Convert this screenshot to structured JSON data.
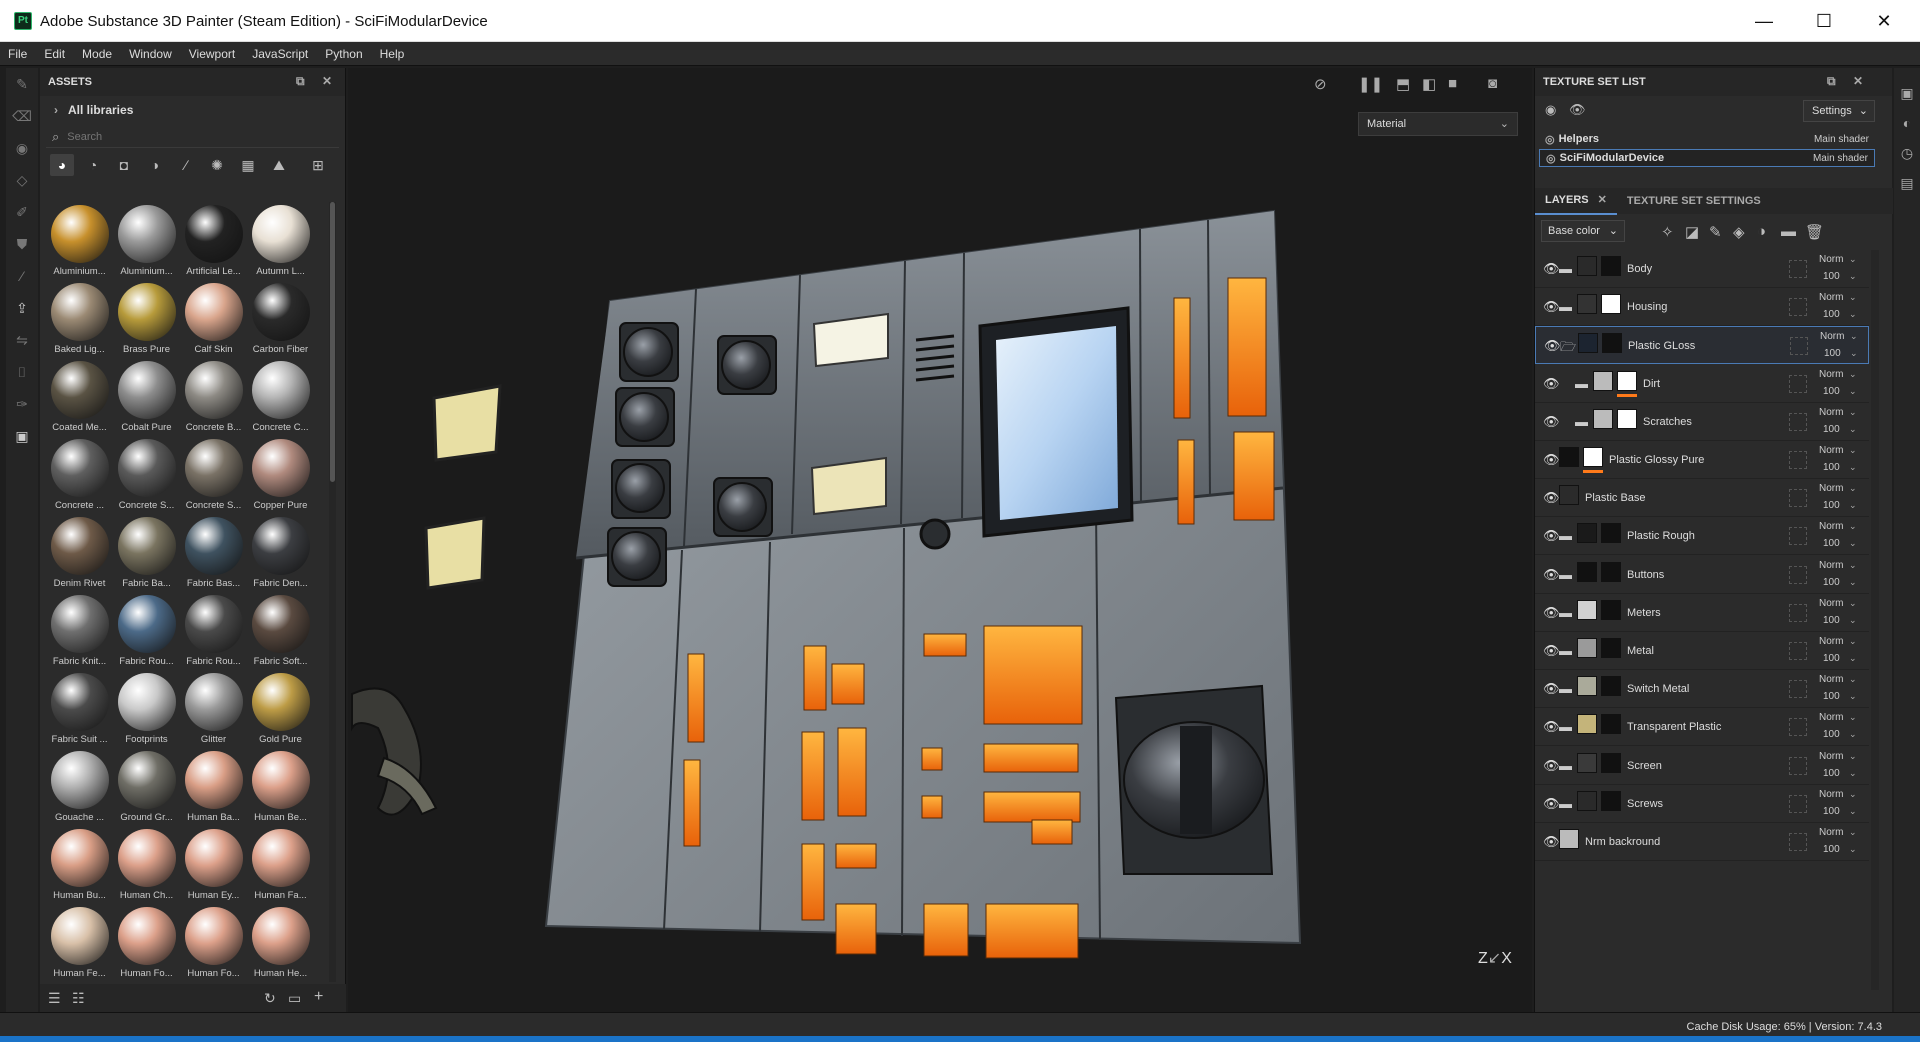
{
  "window": {
    "title": "Adobe Substance 3D Painter (Steam Edition) - SciFiModularDevice",
    "app_icon": "Pt",
    "minimize": "—",
    "maximize": "☐",
    "close": "✕"
  },
  "menu": [
    "File",
    "Edit",
    "Mode",
    "Window",
    "Viewport",
    "JavaScript",
    "Python",
    "Help"
  ],
  "assets": {
    "title": "ASSETS",
    "library": "All libraries",
    "search_placeholder": "Search",
    "items": [
      {
        "label": "Aluminium...",
        "color": "#c7902c"
      },
      {
        "label": "Aluminium...",
        "color": "#9a9a9a"
      },
      {
        "label": "Artificial Le...",
        "color": "#222222"
      },
      {
        "label": "Autumn L...",
        "color": "#e8e0d4"
      },
      {
        "label": "Baked Lig...",
        "color": "#9b8a74"
      },
      {
        "label": "Brass Pure",
        "color": "#b79b3b"
      },
      {
        "label": "Calf Skin",
        "color": "#d9a58c"
      },
      {
        "label": "Carbon Fiber",
        "color": "#2a2a2a"
      },
      {
        "label": "Coated Me...",
        "color": "#5a5344"
      },
      {
        "label": "Cobalt Pure",
        "color": "#8d8d8d"
      },
      {
        "label": "Concrete B...",
        "color": "#8d8a84"
      },
      {
        "label": "Concrete C...",
        "color": "#b5b5b5"
      },
      {
        "label": "Concrete ...",
        "color": "#5f5f5f"
      },
      {
        "label": "Concrete S...",
        "color": "#5a5a5a"
      },
      {
        "label": "Concrete S...",
        "color": "#7a7266"
      },
      {
        "label": "Copper Pure",
        "color": "#b08a7e"
      },
      {
        "label": "Denim Rivet",
        "color": "#6e5a48"
      },
      {
        "label": "Fabric Ba...",
        "color": "#7a7460"
      },
      {
        "label": "Fabric Bas...",
        "color": "#3f5260"
      },
      {
        "label": "Fabric Den...",
        "color": "#3c3e42"
      },
      {
        "label": "Fabric Knit...",
        "color": "#6f6f6f"
      },
      {
        "label": "Fabric Rou...",
        "color": "#4c6a88"
      },
      {
        "label": "Fabric Rou...",
        "color": "#4a4a4a"
      },
      {
        "label": "Fabric Soft...",
        "color": "#5a4a40"
      },
      {
        "label": "Fabric Suit ...",
        "color": "#4b4b4b"
      },
      {
        "label": "Footprints",
        "color": "#c9c9c9"
      },
      {
        "label": "Glitter",
        "color": "#9a9a9a"
      },
      {
        "label": "Gold Pure",
        "color": "#bd9c46"
      },
      {
        "label": "Gouache ...",
        "color": "#b0b0b0"
      },
      {
        "label": "Ground Gr...",
        "color": "#6f6e66"
      },
      {
        "label": "Human Ba...",
        "color": "#d99e86"
      },
      {
        "label": "Human Be...",
        "color": "#dca08a"
      },
      {
        "label": "Human Bu...",
        "color": "#d99e86"
      },
      {
        "label": "Human Ch...",
        "color": "#dca08a"
      },
      {
        "label": "Human Ey...",
        "color": "#dca08a"
      },
      {
        "label": "Human Fa...",
        "color": "#dca08a"
      },
      {
        "label": "Human Fe...",
        "color": "#d8c0a8"
      },
      {
        "label": "Human Fo...",
        "color": "#dca08a"
      },
      {
        "label": "Human Fo...",
        "color": "#dca08a"
      },
      {
        "label": "Human He...",
        "color": "#dca08a"
      }
    ]
  },
  "viewport": {
    "mode": "Material"
  },
  "texture_set_list": {
    "title": "TEXTURE SET LIST",
    "settings": "Settings",
    "sets": [
      {
        "name": "Helpers",
        "shader": "Main shader"
      },
      {
        "name": "SciFiModularDevice",
        "shader": "Main shader"
      }
    ]
  },
  "layers_panel": {
    "tab_layers": "LAYERS",
    "tab_settings": "TEXTURE SET SETTINGS",
    "channel": "Base color",
    "layers": [
      {
        "name": "Body",
        "blend": "Norm",
        "opacity": "100",
        "folder": true,
        "indent": 0,
        "thumb1": "#2a2a2a",
        "thumb2": "#111111",
        "bar": false
      },
      {
        "name": "Housing",
        "blend": "Norm",
        "opacity": "100",
        "folder": true,
        "indent": 0,
        "thumb1": "#333333",
        "thumb2": "#ffffff",
        "bar": false
      },
      {
        "name": "Plastic GLoss",
        "blend": "Norm",
        "opacity": "100",
        "folder": true,
        "indent": 0,
        "thumb1": "#1c2430",
        "thumb2": "#111111",
        "bar": false
      },
      {
        "name": "Dirt",
        "blend": "Norm",
        "opacity": "100",
        "folder": true,
        "indent": 1,
        "thumb1": "#bbbbbb",
        "thumb2": "#ffffff",
        "bar": true
      },
      {
        "name": "Scratches",
        "blend": "Norm",
        "opacity": "100",
        "folder": true,
        "indent": 1,
        "thumb1": "#bbbbbb",
        "thumb2": "#ffffff",
        "bar": false
      },
      {
        "name": "Plastic Glossy Pure",
        "blend": "Norm",
        "opacity": "100",
        "folder": false,
        "indent": 0,
        "thumb1": "#111111",
        "thumb2": "#ffffff",
        "bar": true
      },
      {
        "name": "Plastic Base",
        "blend": "Norm",
        "opacity": "100",
        "folder": false,
        "indent": 0,
        "thumb1": "#2b2b2b",
        "thumb2": "",
        "bar": false
      },
      {
        "name": "Plastic Rough",
        "blend": "Norm",
        "opacity": "100",
        "folder": true,
        "indent": 0,
        "thumb1": "#1a1a1a",
        "thumb2": "#111111",
        "bar": false
      },
      {
        "name": "Buttons",
        "blend": "Norm",
        "opacity": "100",
        "folder": true,
        "indent": 0,
        "thumb1": "#111111",
        "thumb2": "#111111",
        "bar": false
      },
      {
        "name": "Meters",
        "blend": "Norm",
        "opacity": "100",
        "folder": true,
        "indent": 0,
        "thumb1": "#d0d0d0",
        "thumb2": "#111111",
        "bar": false
      },
      {
        "name": "Metal",
        "blend": "Norm",
        "opacity": "100",
        "folder": true,
        "indent": 0,
        "thumb1": "#9a9a9a",
        "thumb2": "#111111",
        "bar": false
      },
      {
        "name": "Switch Metal",
        "blend": "Norm",
        "opacity": "100",
        "folder": true,
        "indent": 0,
        "thumb1": "#aaaa9a",
        "thumb2": "#111111",
        "bar": false
      },
      {
        "name": "Transparent Plastic",
        "blend": "Norm",
        "opacity": "100",
        "folder": true,
        "indent": 0,
        "thumb1": "#c4b47a",
        "thumb2": "#111111",
        "bar": false
      },
      {
        "name": "Screen",
        "blend": "Norm",
        "opacity": "100",
        "folder": true,
        "indent": 0,
        "thumb1": "#3a3a3a",
        "thumb2": "#111111",
        "bar": false
      },
      {
        "name": "Screws",
        "blend": "Norm",
        "opacity": "100",
        "folder": true,
        "indent": 0,
        "thumb1": "#2a2a2a",
        "thumb2": "#111111",
        "bar": false
      },
      {
        "name": "Nrm backround",
        "blend": "Norm",
        "opacity": "100",
        "folder": false,
        "indent": 0,
        "thumb1": "#bbbbbb",
        "thumb2": "",
        "bar": false
      }
    ]
  },
  "status": {
    "text": "Cache Disk Usage:    65% | Version: 7.4.3"
  },
  "colors": {
    "accent": "#4a7ab5",
    "orange": "#ff7a1a",
    "taskbar": "#1a73c8"
  }
}
